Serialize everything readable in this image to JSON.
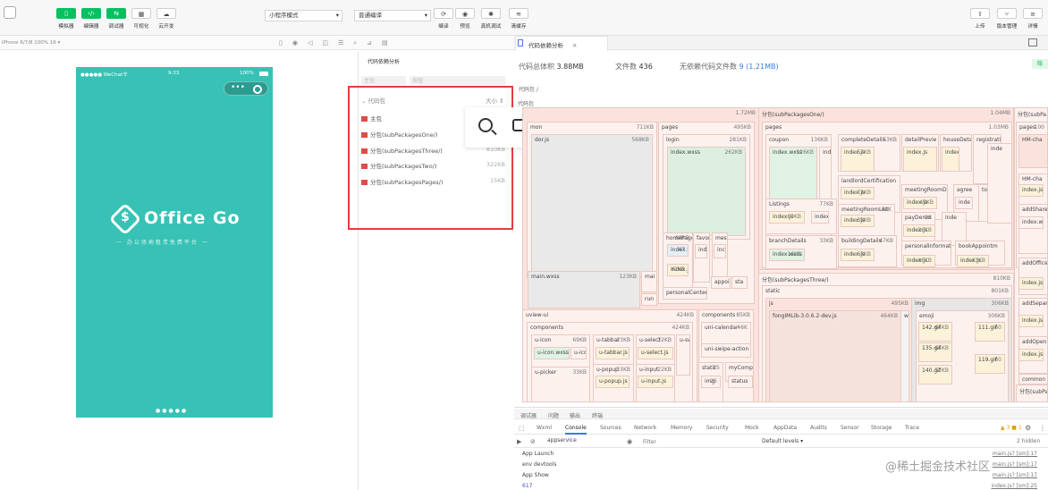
{
  "toolbar": {
    "buttons": [
      {
        "label": "模拟器",
        "icon": "phone-icon"
      },
      {
        "label": "编辑器",
        "icon": "code-icon"
      },
      {
        "label": "调试器",
        "icon": "debug-icon"
      },
      {
        "label": "可视化",
        "icon": "layout-icon"
      },
      {
        "label": "云开发",
        "icon": "cloud-icon"
      }
    ],
    "mode_select": "小程序模式",
    "compile_select": "普通编译",
    "actions": [
      "编译",
      "预览",
      "真机调试",
      "清缓存"
    ],
    "right_actions": [
      "上传",
      "版本管理",
      "详情"
    ]
  },
  "subbar": {
    "device": "iPhone 6/7/8 100% 16 ▾"
  },
  "phone": {
    "status_left": "●●●●● WeChat令",
    "time": "9:33",
    "battery": "100%",
    "logo_text": "Office Go",
    "slogan": "一 办公场地租赁免费平台 一"
  },
  "mid": {
    "header": "代码依赖分析",
    "select1": "主包",
    "select2": "按钮",
    "list_header": "代码包",
    "list_size": "大小 ↕",
    "files": [
      {
        "name": "主包",
        "size": ""
      },
      {
        "name": "分包(subPackagesOne/)",
        "size": ""
      },
      {
        "name": "分包(subPackagesThree/)",
        "size": "810KB"
      },
      {
        "name": "分包(subPackagesTwo/)",
        "size": "322KB"
      },
      {
        "name": "分包(subPackagesPages/)",
        "size": "15KB"
      }
    ]
  },
  "analysis": {
    "tab_label": "代码依赖分析",
    "total_label": "代码总体积",
    "total_value": "3.88MB",
    "files_label": "文件数",
    "files_value": "436",
    "nodep_label": "无依赖代码文件数",
    "nodep_value": "9 (1.21MB)",
    "breadcrumb": "代码包 /",
    "root_label": "代码包",
    "badge": "隐"
  },
  "treemap": [
    {
      "n": "",
      "s": "1.72MB"
    },
    {
      "n": "mon",
      "s": "711KB"
    },
    {
      "n": "dor.js",
      "s": "568KB"
    },
    {
      "n": "pages",
      "s": "495KB"
    },
    {
      "n": "login",
      "s": "281KB"
    },
    {
      "n": "index.wxss",
      "s": "262KB"
    },
    {
      "n": "homePage",
      "s": "88KB"
    },
    {
      "n": "index.wxml",
      "s": "47"
    },
    {
      "n": "index.js",
      "s": "42KB"
    },
    {
      "n": "favori",
      "s": ""
    },
    {
      "n": "ind",
      "s": ""
    },
    {
      "n": "mess",
      "s": ""
    },
    {
      "n": "inc",
      "s": ""
    },
    {
      "n": "appoin",
      "s": ""
    },
    {
      "n": "sta",
      "s": ""
    },
    {
      "n": "personalCenter2",
      "s": ""
    },
    {
      "n": "main.wxss",
      "s": "123KB"
    },
    {
      "n": "mai",
      "s": ""
    },
    {
      "n": "run",
      "s": ""
    },
    {
      "n": "uview-ui",
      "s": "424KB"
    },
    {
      "n": "components",
      "s": "424KB"
    },
    {
      "n": "u-icon",
      "s": "69KB"
    },
    {
      "n": "u-icon.wxss",
      "s": ""
    },
    {
      "n": "u-icc",
      "s": ""
    },
    {
      "n": "u-tabbar",
      "s": "23KB"
    },
    {
      "n": "u-tabbar.js",
      "s": ""
    },
    {
      "n": "u-select",
      "s": "22KB"
    },
    {
      "n": "u-select.js",
      "s": ""
    },
    {
      "n": "u-swi",
      "s": ""
    },
    {
      "n": "u-picker",
      "s": "33KB"
    },
    {
      "n": "u-popup",
      "s": "23KB"
    },
    {
      "n": "u-popup.js",
      "s": ""
    },
    {
      "n": "u-input",
      "s": "22KB"
    },
    {
      "n": "u-input.js",
      "s": ""
    },
    {
      "n": "components",
      "s": "85KB"
    },
    {
      "n": "uni-calendar",
      "s": "46K"
    },
    {
      "n": "uni-swipe-action",
      "s": ""
    },
    {
      "n": "static",
      "s": "25"
    },
    {
      "n": "img",
      "s": "25"
    },
    {
      "n": "myComp",
      "s": ""
    },
    {
      "n": "status",
      "s": ""
    },
    {
      "n": "分包(subPackagesOne/)",
      "s": "1.04MB"
    },
    {
      "n": "pages",
      "s": "1.03MB"
    },
    {
      "n": "coupon",
      "s": "136KB"
    },
    {
      "n": "index.wxss",
      "s": "126KB"
    },
    {
      "n": "ind",
      "s": ""
    },
    {
      "n": "completeDetails",
      "s": "53KB"
    },
    {
      "n": "index.js",
      "s": "52KB"
    },
    {
      "n": "detailPrevie",
      "s": ""
    },
    {
      "n": "index.js",
      "s": ""
    },
    {
      "n": "houseDeta",
      "s": ""
    },
    {
      "n": "index.js",
      "s": ""
    },
    {
      "n": "registrati",
      "s": ""
    },
    {
      "n": "landlordCertification",
      "s": ""
    },
    {
      "n": "index.js",
      "s": "71KB"
    },
    {
      "n": "meetingRoomDe",
      "s": ""
    },
    {
      "n": "index.js",
      "s": "49KB"
    },
    {
      "n": "agree",
      "s": ""
    },
    {
      "n": "inde",
      "s": ""
    },
    {
      "n": "toFind",
      "s": ""
    },
    {
      "n": "Listings",
      "s": "77KB"
    },
    {
      "n": "index.js",
      "s": "60KB"
    },
    {
      "n": "index.w",
      "s": ""
    },
    {
      "n": "meetingRoomList",
      "s": "48K"
    },
    {
      "n": "index.js",
      "s": "39KB"
    },
    {
      "n": "payDemo",
      "s": "28"
    },
    {
      "n": "index.js",
      "s": "26KB"
    },
    {
      "n": "inde",
      "s": ""
    },
    {
      "n": "branchDetails",
      "s": "33KB"
    },
    {
      "n": "index.wxss",
      "s": "16KB"
    },
    {
      "n": "buildingDetails",
      "s": "47KB"
    },
    {
      "n": "index.js",
      "s": "68KB"
    },
    {
      "n": "personalInformat",
      "s": ""
    },
    {
      "n": "index.js",
      "s": "46KB"
    },
    {
      "n": "bookAppointm",
      "s": ""
    },
    {
      "n": "index.js",
      "s": "43KB"
    },
    {
      "n": "inde",
      "s": ""
    },
    {
      "n": "分包(subPackagesThree/)",
      "s": "810KB"
    },
    {
      "n": "static",
      "s": "801KB"
    },
    {
      "n": "js",
      "s": "495KB"
    },
    {
      "n": "fongIMLib-3.0.6.2-dev.js",
      "s": "464KB"
    },
    {
      "n": "w",
      "s": ""
    },
    {
      "n": "img",
      "s": "306KB"
    },
    {
      "n": "emoji",
      "s": "306KB"
    },
    {
      "n": "142.gif",
      "s": "64KB"
    },
    {
      "n": "111.gif",
      "s": "60"
    },
    {
      "n": "135.gif",
      "s": "64KB"
    },
    {
      "n": "119.gif",
      "s": "60"
    },
    {
      "n": "140.gif",
      "s": "52KB"
    },
    {
      "n": "分包(subPa",
      "s": ""
    },
    {
      "n": "pages",
      "s": "100"
    },
    {
      "n": "HM-cha",
      "s": ""
    },
    {
      "n": "HM-cha",
      "s": ""
    },
    {
      "n": "index.js",
      "s": ""
    },
    {
      "n": "addShare",
      "s": ""
    },
    {
      "n": "index.wi",
      "s": ""
    },
    {
      "n": "addOffice",
      "s": ""
    },
    {
      "n": "index.js",
      "s": ""
    },
    {
      "n": "addSepar",
      "s": ""
    },
    {
      "n": "index.js",
      "s": ""
    },
    {
      "n": "addOpen",
      "s": ""
    },
    {
      "n": "index.js",
      "s": ""
    },
    {
      "n": "common",
      "s": ""
    },
    {
      "n": "分包(subPa",
      "s": ""
    }
  ],
  "console": {
    "top_tabs": [
      "调试器",
      "问题",
      "输出",
      "终端"
    ],
    "tabs": [
      "Wxml",
      "Console",
      "Sources",
      "Network",
      "Memory",
      "Security",
      "Mock",
      "AppData",
      "Audits",
      "Sensor",
      "Storage",
      "Trace"
    ],
    "active_tab": "Console",
    "counts": "▲ 3  ■ 1",
    "context": "appservice",
    "filter_placeholder": "Filter",
    "levels": "Default levels ▾",
    "hidden": "2 hidden",
    "lines": [
      {
        "text": "App Launch",
        "src": "main.js? [sm]:17"
      },
      {
        "text": "env devtools",
        "src": "main.js? [sm]:17"
      },
      {
        "text": "App Show",
        "src": "main.js? [sm]:17"
      },
      {
        "text": "617",
        "src": "index.js? [sm]:25"
      }
    ]
  },
  "watermark": "@稀土掘金技术社区"
}
